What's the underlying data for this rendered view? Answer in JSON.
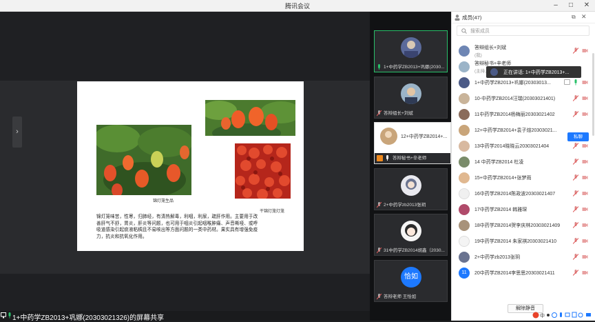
{
  "window": {
    "title": "腾讯会议"
  },
  "stage": {
    "slide": {
      "caption_1": "锦灯笼生品",
      "caption_2": "干锦灯笼灯笼",
      "body": "锦灯笼味苦，性寒，归肺经，有清热解毒，利咽，利尿，疏肝作用。主要用于改善肝气不舒，胃炎，肝炎等问题，也可用于咽炎引起咽喉肿痛、声音嘶哑、或呼吸道感染引起痰液粘稠且不易咳出等方面问题的一类中药材。果实具有增强免疫力，抗炎和抗氧化作用。"
    },
    "status_text": "1+中药学ZB2013+巩娜(20303021326)的屏幕共享"
  },
  "filmstrip": {
    "tiles": [
      {
        "label": "1+中药学ZB2013+巩娜(2030..."
      },
      {
        "label": "答辩组长+刘斌"
      },
      {
        "label": "12+中药学ZB2014+...",
        "sub_label": "答辩秘书+辛老师"
      },
      {
        "label": "2+中药学zb2013张玥"
      },
      {
        "label": "31中药学ZB2014胡鑫（2030..."
      },
      {
        "label": "答辩老师 王恰如",
        "avatar_text": "恰如"
      }
    ]
  },
  "members": {
    "header": "成员(47)",
    "search_placeholder": "搜索成员",
    "speaking_tooltip": "正在讲话: 1+中药学ZB2013+...",
    "private_chat_label": "私聊",
    "unmute_label": "解除静音",
    "items": [
      {
        "name": "答辩组长+刘斌",
        "sub": "(我)"
      },
      {
        "name": "答辩秘书+辛老师",
        "sub": "(主持人)"
      },
      {
        "name": "1+中药学ZB2013+巩娜(20303013..."
      },
      {
        "name": "10-中药学ZB2014汪瑞(20303021401)"
      },
      {
        "name": "11中药学ZB2014杨梅丽20303021402"
      },
      {
        "name": "12+中药学ZB2014+袁子煊20303021..."
      },
      {
        "name": "13中药学2014晓晓云20303021404"
      },
      {
        "name": "14 中药学ZB2014 杜凌"
      },
      {
        "name": "15+中药学ZB2014+张梦雨"
      },
      {
        "name": "16中药学ZB2014陈政波20303021407"
      },
      {
        "name": "17中药学ZB2014 韩雅琛"
      },
      {
        "name": "18中药学ZB2014贺李庆林20303021409"
      },
      {
        "name": "19中药学ZB2014 朱家祺20303021410"
      },
      {
        "name": "2+中药学zb2013张玥"
      },
      {
        "name": "20中药学ZB2014李思思20303021411",
        "avatar_text": "11"
      }
    ]
  },
  "colors": {
    "accent": "#1d79ff",
    "active_speaker": "#29c16a",
    "muted": "#e05a5a"
  }
}
